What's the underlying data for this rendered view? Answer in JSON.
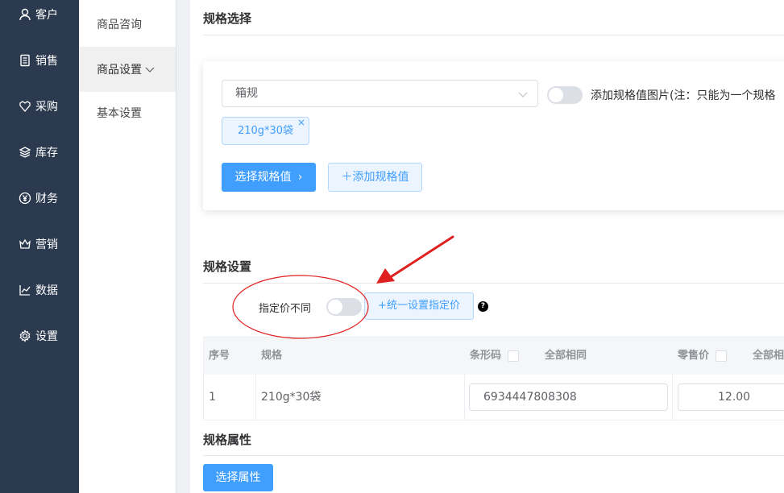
{
  "nav": {
    "items": [
      {
        "label": "客户",
        "icon": "user-icon"
      },
      {
        "label": "销售",
        "icon": "document-icon"
      },
      {
        "label": "采购",
        "icon": "purchase-icon"
      },
      {
        "label": "库存",
        "icon": "layers-icon"
      },
      {
        "label": "财务",
        "icon": "yen-icon"
      },
      {
        "label": "营销",
        "icon": "crown-icon"
      },
      {
        "label": "数据",
        "icon": "line-chart-icon"
      },
      {
        "label": "设置",
        "icon": "gear-icon"
      }
    ]
  },
  "submenu": {
    "items": [
      {
        "label": "商品咨询"
      },
      {
        "label": "商品设置",
        "active": true
      },
      {
        "label": "基本设置"
      }
    ]
  },
  "spec_select": {
    "title": "规格选择",
    "dropdown_value": "箱规",
    "image_toggle_label": "添加规格值图片(注：只能为一个规格",
    "tag": "210g*30袋",
    "tag_close": "×",
    "choose_button": "选择规格值",
    "add_button": "添加规格值"
  },
  "spec_settings": {
    "title": "规格设置",
    "diff_price_label": "指定价不同",
    "unified_button": "+统一设置指定价",
    "help": "?",
    "table": {
      "headers": {
        "index": "序号",
        "spec": "规格",
        "barcode": "条形码",
        "barcode_all_same": "全部相同",
        "retail": "零售价",
        "retail_all_same": "全部相"
      },
      "rows": [
        {
          "index": "1",
          "spec": "210g*30袋",
          "barcode": "6934447808308",
          "retail": "12.00"
        }
      ]
    }
  },
  "spec_attrs": {
    "title": "规格属性",
    "choose_button": "选择属性"
  },
  "colors": {
    "nav_bg": "#2c3a4f",
    "primary": "#409eff",
    "annotation_red": "#e02020"
  }
}
